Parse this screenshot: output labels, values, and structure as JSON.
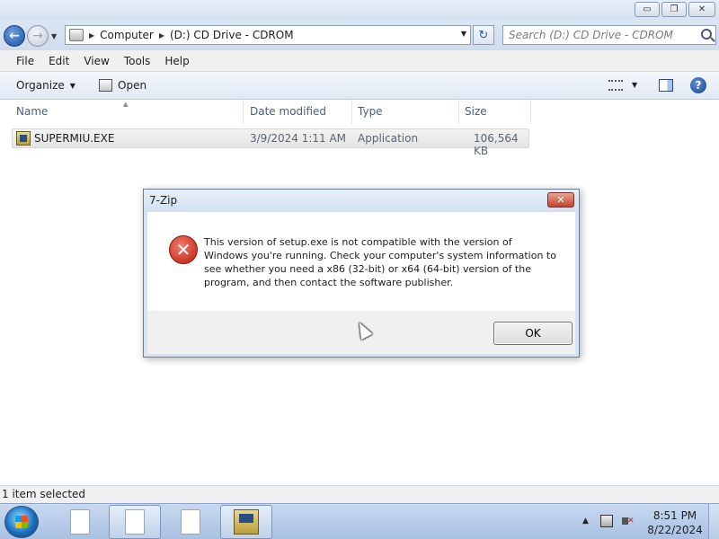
{
  "window": {
    "minimize_label": "▭",
    "maximize_label": "❐",
    "close_label": "✕"
  },
  "address": {
    "crumbs": [
      "Computer",
      "(D:) CD Drive - CDROM"
    ],
    "refresh_symbol": "↻"
  },
  "search": {
    "placeholder": "Search (D:) CD Drive - CDROM"
  },
  "menu": {
    "items": [
      "File",
      "Edit",
      "View",
      "Tools",
      "Help"
    ]
  },
  "commands": {
    "organize": "Organize",
    "open": "Open",
    "help_symbol": "?"
  },
  "columns": [
    "Name",
    "Date modified",
    "Type",
    "Size"
  ],
  "files": [
    {
      "name": "SUPERMIU.EXE",
      "date_modified": "3/9/2024 1:11 AM",
      "type": "Application",
      "size": "106,564 KB"
    }
  ],
  "dialog": {
    "title": "7-Zip",
    "close_label": "✕",
    "message": "This version of setup.exe is not compatible with the version of Windows you're running. Check your computer's system information to see whether you need a x86 (32-bit) or x64 (64-bit) version of the program, and then contact the software publisher.",
    "ok_label": "OK"
  },
  "status": {
    "text": "1 item selected"
  },
  "taskbar": {
    "tray_arrow": "▲",
    "time": "8:51 PM",
    "date": "8/22/2024"
  },
  "colors": {
    "accent": "#1b4f9e",
    "error": "#b81d10",
    "taskbar": "#a9c1e3"
  }
}
